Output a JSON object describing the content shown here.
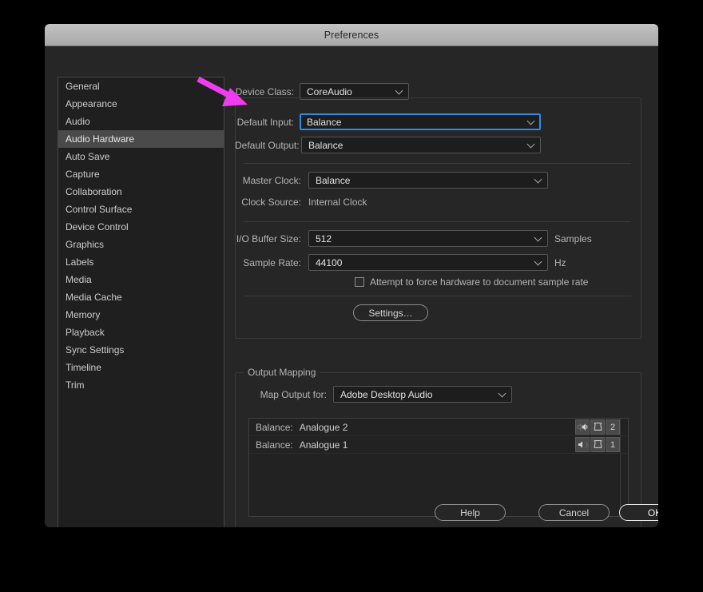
{
  "window": {
    "title": "Preferences"
  },
  "sidebar": {
    "items": [
      {
        "label": "General",
        "selected": false
      },
      {
        "label": "Appearance",
        "selected": false
      },
      {
        "label": "Audio",
        "selected": false
      },
      {
        "label": "Audio Hardware",
        "selected": true
      },
      {
        "label": "Auto Save",
        "selected": false
      },
      {
        "label": "Capture",
        "selected": false
      },
      {
        "label": "Collaboration",
        "selected": false
      },
      {
        "label": "Control Surface",
        "selected": false
      },
      {
        "label": "Device Control",
        "selected": false
      },
      {
        "label": "Graphics",
        "selected": false
      },
      {
        "label": "Labels",
        "selected": false
      },
      {
        "label": "Media",
        "selected": false
      },
      {
        "label": "Media Cache",
        "selected": false
      },
      {
        "label": "Memory",
        "selected": false
      },
      {
        "label": "Playback",
        "selected": false
      },
      {
        "label": "Sync Settings",
        "selected": false
      },
      {
        "label": "Timeline",
        "selected": false
      },
      {
        "label": "Trim",
        "selected": false
      }
    ]
  },
  "device_settings": {
    "device_class": {
      "label": "Device Class:",
      "value": "CoreAudio"
    },
    "default_input": {
      "label": "Default Input:",
      "value": "Balance",
      "focused": true
    },
    "default_output": {
      "label": "Default Output:",
      "value": "Balance"
    },
    "master_clock": {
      "label": "Master Clock:",
      "value": "Balance"
    },
    "clock_source": {
      "label": "Clock Source:",
      "value": "Internal Clock"
    },
    "io_buffer_size": {
      "label": "I/O Buffer Size:",
      "value": "512",
      "unit": "Samples"
    },
    "sample_rate": {
      "label": "Sample Rate:",
      "value": "44100",
      "unit": "Hz"
    },
    "force_hardware_checkbox": {
      "label": "Attempt to force hardware to document sample rate",
      "checked": false
    },
    "settings_button": {
      "label": "Settings…"
    }
  },
  "output_mapping": {
    "title": "Output Mapping",
    "map_output_for": {
      "label": "Map Output for:",
      "value": "Adobe Desktop Audio"
    },
    "rows": [
      {
        "device": "Balance:",
        "channel": "Analogue 1",
        "pan_icon": "speaker-left-icon",
        "clip_icon": "speaker-outline-icon",
        "number": "1"
      },
      {
        "device": "Balance:",
        "channel": "Analogue 2",
        "pan_icon": "speaker-right-icon",
        "clip_icon": "speaker-outline-icon",
        "number": "2"
      }
    ]
  },
  "footer": {
    "help": "Help",
    "cancel": "Cancel",
    "ok": "OK"
  },
  "annotation": {
    "arrow_color": "#f03cf0",
    "arrow_name": "pink-pointer-arrow"
  },
  "colors": {
    "focus_blue": "#2f8ce5",
    "window_bg": "#262626",
    "sidebar_bg": "#1f1f1f",
    "selected_row": "#4a4a4a"
  }
}
